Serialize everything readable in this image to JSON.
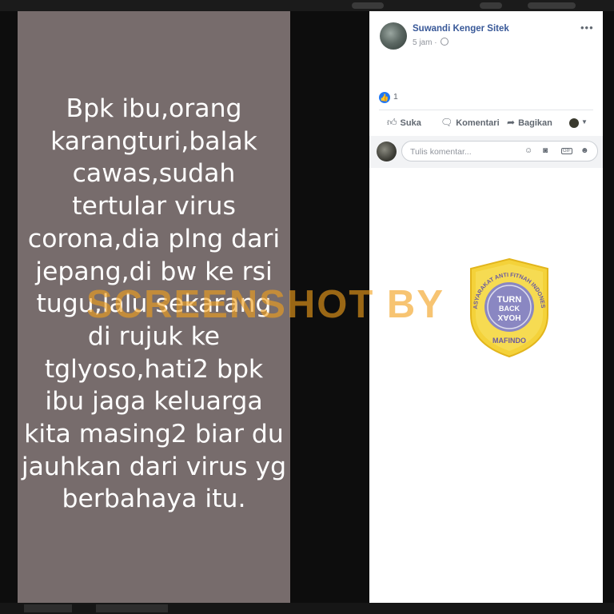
{
  "post": {
    "text": "Bpk ibu,orang\nkarangturi,balak\ncawas,sudah\ntertular virus\ncorona,dia plng dari\njepang,di bw ke rsi\ntugu,lalu sekarang\ndi rujuk ke\ntglyoso,hati2 bpk\nibu jaga keluarga\nkita masing2 biar du\njauhkan dari virus yg\nberbahaya itu.",
    "author": "Suwandi Kenger Sitek",
    "time": "5 jam",
    "separator": "·",
    "more_label": "•••",
    "like_count": "1"
  },
  "actions": {
    "like_label": "Suka",
    "comment_label": "Komentari",
    "share_label": "Bagikan"
  },
  "comment": {
    "placeholder": "Tulis komentar...",
    "gif_label": "GIF"
  },
  "watermark": {
    "text": "SCREENSHOT BY",
    "color": "#f2a01c"
  },
  "logo": {
    "arc_text": "MASYARAKAT ANTI FITNAH INDONESIA",
    "line1": "TURN",
    "line2": "BACK",
    "line3": "HOAX",
    "bottom": "MAFINDO"
  },
  "colors": {
    "background": "#776c6c",
    "author_link": "#385898",
    "like_blue": "#2078f4"
  },
  "icons": [
    "thumbs-up-icon",
    "comment-icon",
    "share-icon",
    "globe-icon",
    "smiley-icon",
    "camera-icon",
    "gif-icon",
    "sticker-icon"
  ]
}
